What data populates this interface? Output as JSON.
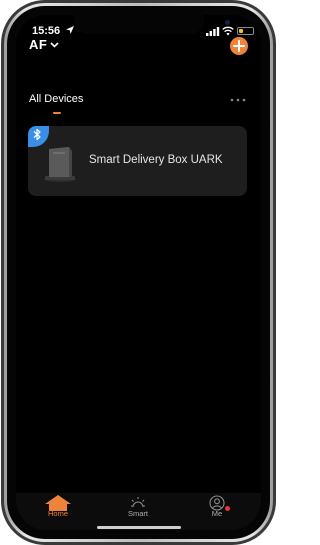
{
  "status": {
    "time": "15:56",
    "icons": [
      "location-icon",
      "signal-icon",
      "wifi-icon",
      "battery-icon"
    ],
    "battery_color": "#f0c419"
  },
  "header": {
    "home_name": "AF",
    "add_icon": "plus-icon",
    "accent": "#f0833a"
  },
  "tabs": {
    "active_label": "All Devices",
    "more_icon": "ellipsis-icon"
  },
  "devices": [
    {
      "name": "Smart Delivery Box UARK",
      "badge_icon": "bluetooth-icon",
      "badge_color": "#3a8ee6"
    }
  ],
  "tabbar": {
    "items": [
      {
        "label": "Home",
        "icon": "home-icon",
        "active": true
      },
      {
        "label": "Smart",
        "icon": "sun-icon",
        "active": false
      },
      {
        "label": "Me",
        "icon": "person-icon",
        "active": false,
        "notification_dot": true
      }
    ]
  }
}
